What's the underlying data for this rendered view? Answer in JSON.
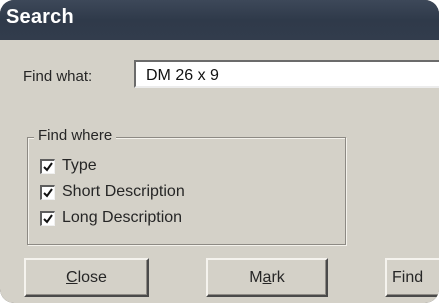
{
  "window": {
    "title": "Search"
  },
  "find_what": {
    "label": "Find what:",
    "value": "DM 26 x 9"
  },
  "find_where": {
    "legend": "Find where",
    "options": [
      {
        "label": "Type",
        "checked": true
      },
      {
        "label": "Short Description",
        "checked": true
      },
      {
        "label": "Long Description",
        "checked": true
      }
    ]
  },
  "buttons": {
    "close": {
      "label": "Close",
      "mnemonic": "C",
      "rest": "lose"
    },
    "mark": {
      "label": "Mark",
      "mnemonic": "a",
      "prefix": "M",
      "rest": "rk"
    },
    "find": {
      "label": "Find"
    }
  },
  "colors": {
    "titlebar": "#323c4c",
    "dialog_face": "#d4d1c8"
  }
}
